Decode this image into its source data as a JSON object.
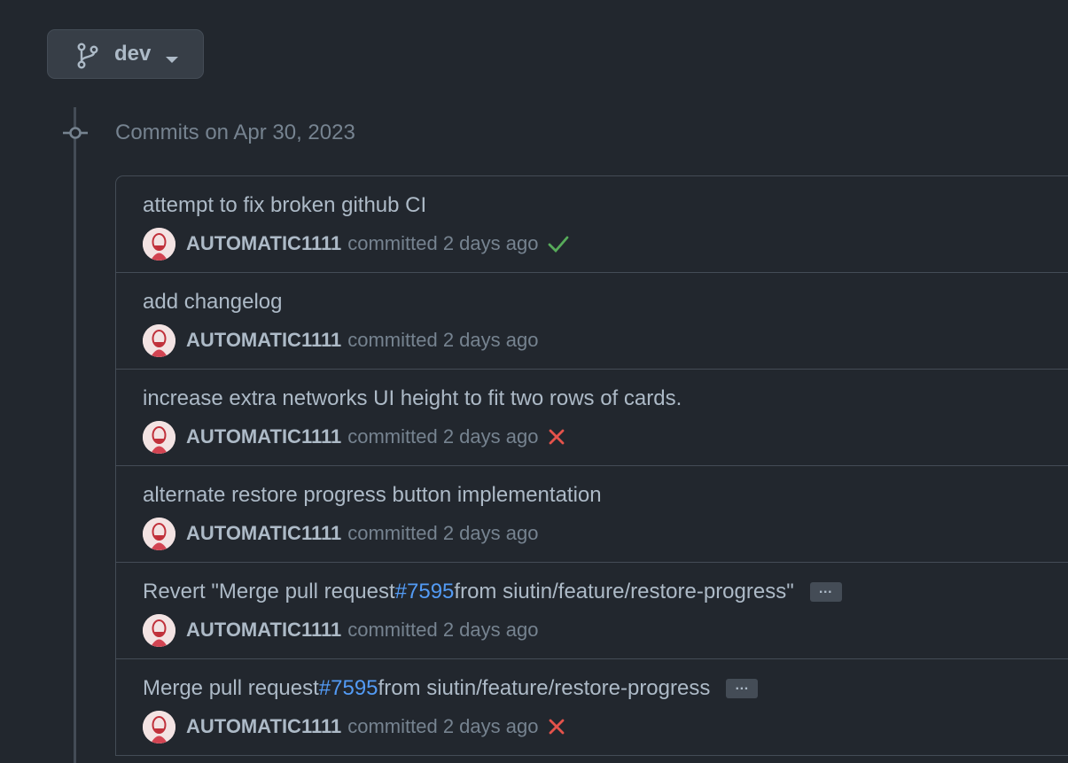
{
  "branch": {
    "name": "dev",
    "icon": "git-branch-icon",
    "caret_icon": "triangle-down-icon"
  },
  "timeline": {
    "date_heading": "Commits on Apr 30, 2023",
    "icon": "git-commit-icon"
  },
  "colors": {
    "background": "#22272e",
    "border": "#444c56",
    "link": "#539bf5",
    "success": "#57ab5a",
    "failure": "#e5534b"
  },
  "commits": [
    {
      "title": "attempt to fix broken github CI",
      "author": "AUTOMATIC1111",
      "committed_text": "committed 2 days ago",
      "status": "success"
    },
    {
      "title": "add changelog",
      "author": "AUTOMATIC1111",
      "committed_text": "committed 2 days ago",
      "status": "none"
    },
    {
      "title": "increase extra networks UI height to fit two rows of cards.",
      "author": "AUTOMATIC1111",
      "committed_text": "committed 2 days ago",
      "status": "failure"
    },
    {
      "title": "alternate restore progress button implementation",
      "author": "AUTOMATIC1111",
      "committed_text": "committed 2 days ago",
      "status": "none"
    },
    {
      "title_prefix": "Revert \"Merge pull request ",
      "pr_link": "#7595",
      "title_suffix": " from siutin/feature/restore-progress\"",
      "ellipsis": "…",
      "author": "AUTOMATIC1111",
      "committed_text": "committed 2 days ago",
      "status": "none"
    },
    {
      "title_prefix": "Merge pull request ",
      "pr_link": "#7595",
      "title_suffix": " from siutin/feature/restore-progress",
      "ellipsis": "…",
      "author": "AUTOMATIC1111",
      "committed_text": "committed 2 days ago",
      "status": "failure"
    }
  ]
}
